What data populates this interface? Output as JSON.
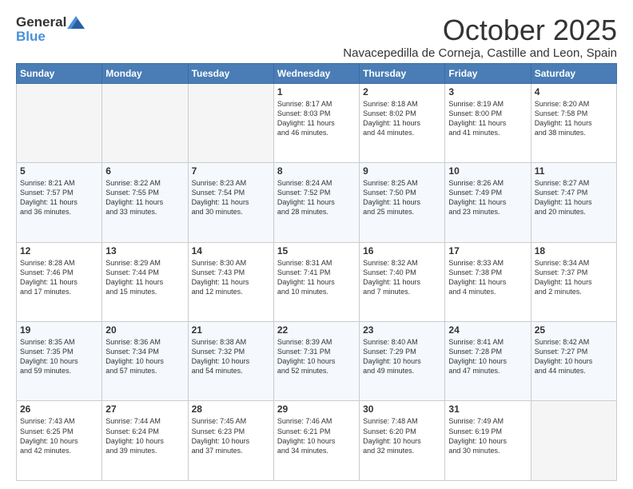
{
  "header": {
    "logo_general": "General",
    "logo_blue": "Blue",
    "month_title": "October 2025",
    "location": "Navacepedilla de Corneja, Castille and Leon, Spain"
  },
  "weekdays": [
    "Sunday",
    "Monday",
    "Tuesday",
    "Wednesday",
    "Thursday",
    "Friday",
    "Saturday"
  ],
  "weeks": [
    [
      {
        "day": "",
        "info": ""
      },
      {
        "day": "",
        "info": ""
      },
      {
        "day": "",
        "info": ""
      },
      {
        "day": "1",
        "info": "Sunrise: 8:17 AM\nSunset: 8:03 PM\nDaylight: 11 hours\nand 46 minutes."
      },
      {
        "day": "2",
        "info": "Sunrise: 8:18 AM\nSunset: 8:02 PM\nDaylight: 11 hours\nand 44 minutes."
      },
      {
        "day": "3",
        "info": "Sunrise: 8:19 AM\nSunset: 8:00 PM\nDaylight: 11 hours\nand 41 minutes."
      },
      {
        "day": "4",
        "info": "Sunrise: 8:20 AM\nSunset: 7:58 PM\nDaylight: 11 hours\nand 38 minutes."
      }
    ],
    [
      {
        "day": "5",
        "info": "Sunrise: 8:21 AM\nSunset: 7:57 PM\nDaylight: 11 hours\nand 36 minutes."
      },
      {
        "day": "6",
        "info": "Sunrise: 8:22 AM\nSunset: 7:55 PM\nDaylight: 11 hours\nand 33 minutes."
      },
      {
        "day": "7",
        "info": "Sunrise: 8:23 AM\nSunset: 7:54 PM\nDaylight: 11 hours\nand 30 minutes."
      },
      {
        "day": "8",
        "info": "Sunrise: 8:24 AM\nSunset: 7:52 PM\nDaylight: 11 hours\nand 28 minutes."
      },
      {
        "day": "9",
        "info": "Sunrise: 8:25 AM\nSunset: 7:50 PM\nDaylight: 11 hours\nand 25 minutes."
      },
      {
        "day": "10",
        "info": "Sunrise: 8:26 AM\nSunset: 7:49 PM\nDaylight: 11 hours\nand 23 minutes."
      },
      {
        "day": "11",
        "info": "Sunrise: 8:27 AM\nSunset: 7:47 PM\nDaylight: 11 hours\nand 20 minutes."
      }
    ],
    [
      {
        "day": "12",
        "info": "Sunrise: 8:28 AM\nSunset: 7:46 PM\nDaylight: 11 hours\nand 17 minutes."
      },
      {
        "day": "13",
        "info": "Sunrise: 8:29 AM\nSunset: 7:44 PM\nDaylight: 11 hours\nand 15 minutes."
      },
      {
        "day": "14",
        "info": "Sunrise: 8:30 AM\nSunset: 7:43 PM\nDaylight: 11 hours\nand 12 minutes."
      },
      {
        "day": "15",
        "info": "Sunrise: 8:31 AM\nSunset: 7:41 PM\nDaylight: 11 hours\nand 10 minutes."
      },
      {
        "day": "16",
        "info": "Sunrise: 8:32 AM\nSunset: 7:40 PM\nDaylight: 11 hours\nand 7 minutes."
      },
      {
        "day": "17",
        "info": "Sunrise: 8:33 AM\nSunset: 7:38 PM\nDaylight: 11 hours\nand 4 minutes."
      },
      {
        "day": "18",
        "info": "Sunrise: 8:34 AM\nSunset: 7:37 PM\nDaylight: 11 hours\nand 2 minutes."
      }
    ],
    [
      {
        "day": "19",
        "info": "Sunrise: 8:35 AM\nSunset: 7:35 PM\nDaylight: 10 hours\nand 59 minutes."
      },
      {
        "day": "20",
        "info": "Sunrise: 8:36 AM\nSunset: 7:34 PM\nDaylight: 10 hours\nand 57 minutes."
      },
      {
        "day": "21",
        "info": "Sunrise: 8:38 AM\nSunset: 7:32 PM\nDaylight: 10 hours\nand 54 minutes."
      },
      {
        "day": "22",
        "info": "Sunrise: 8:39 AM\nSunset: 7:31 PM\nDaylight: 10 hours\nand 52 minutes."
      },
      {
        "day": "23",
        "info": "Sunrise: 8:40 AM\nSunset: 7:29 PM\nDaylight: 10 hours\nand 49 minutes."
      },
      {
        "day": "24",
        "info": "Sunrise: 8:41 AM\nSunset: 7:28 PM\nDaylight: 10 hours\nand 47 minutes."
      },
      {
        "day": "25",
        "info": "Sunrise: 8:42 AM\nSunset: 7:27 PM\nDaylight: 10 hours\nand 44 minutes."
      }
    ],
    [
      {
        "day": "26",
        "info": "Sunrise: 7:43 AM\nSunset: 6:25 PM\nDaylight: 10 hours\nand 42 minutes."
      },
      {
        "day": "27",
        "info": "Sunrise: 7:44 AM\nSunset: 6:24 PM\nDaylight: 10 hours\nand 39 minutes."
      },
      {
        "day": "28",
        "info": "Sunrise: 7:45 AM\nSunset: 6:23 PM\nDaylight: 10 hours\nand 37 minutes."
      },
      {
        "day": "29",
        "info": "Sunrise: 7:46 AM\nSunset: 6:21 PM\nDaylight: 10 hours\nand 34 minutes."
      },
      {
        "day": "30",
        "info": "Sunrise: 7:48 AM\nSunset: 6:20 PM\nDaylight: 10 hours\nand 32 minutes."
      },
      {
        "day": "31",
        "info": "Sunrise: 7:49 AM\nSunset: 6:19 PM\nDaylight: 10 hours\nand 30 minutes."
      },
      {
        "day": "",
        "info": ""
      }
    ]
  ]
}
